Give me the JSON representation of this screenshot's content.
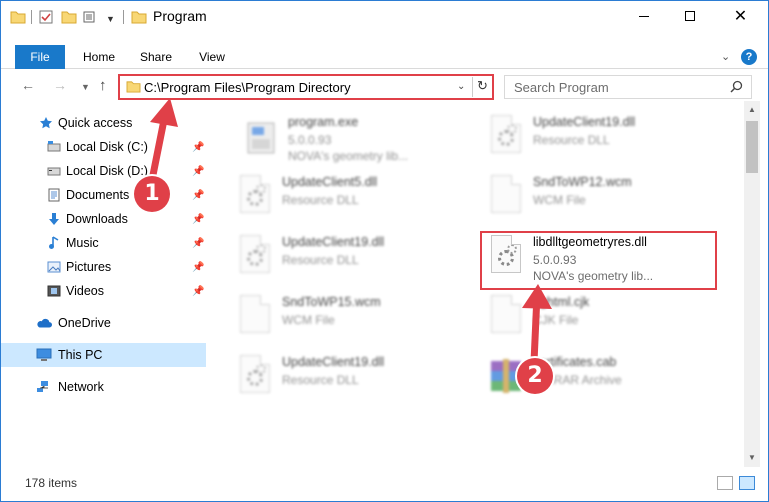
{
  "window": {
    "title": "Program",
    "controls": {
      "minimize": "",
      "maximize": "",
      "close": "✕"
    }
  },
  "ribbon": {
    "tabs": [
      "File",
      "Home",
      "Share",
      "View"
    ]
  },
  "address": {
    "path": "C:\\Program Files\\Program Directory",
    "search_placeholder": "Search Program"
  },
  "sidebar": {
    "quick_access": "Quick access",
    "pinned": [
      {
        "label": "Local Disk (C:)",
        "icon": "drive-icon"
      },
      {
        "label": "Local Disk (D:)",
        "icon": "drive-icon"
      },
      {
        "label": "Documents",
        "icon": "documents-icon"
      },
      {
        "label": "Downloads",
        "icon": "downloads-icon"
      },
      {
        "label": "Music",
        "icon": "music-icon"
      },
      {
        "label": "Pictures",
        "icon": "pictures-icon"
      },
      {
        "label": "Videos",
        "icon": "videos-icon"
      }
    ],
    "onedrive": "OneDrive",
    "this_pc": "This PC",
    "network": "Network"
  },
  "files": [
    {
      "name": "program.exe",
      "line2": "5.0.0.93",
      "line3": "NOVA's geometry lib...",
      "icon": "exe-icon",
      "blurred": true
    },
    {
      "name": "UpdateClient19.dll",
      "line2": "Resource DLL",
      "line3": "",
      "icon": "dll-icon",
      "blurred": true
    },
    {
      "name": "UpdateClient5.dll",
      "line2": "Resource DLL",
      "line3": "",
      "icon": "dll-icon",
      "blurred": true
    },
    {
      "name": "SndToWP12.wcm",
      "line2": "WCM File",
      "line3": "",
      "icon": "file-icon",
      "blurred": true
    },
    {
      "name": "UpdateClient19.dll",
      "line2": "Resource DLL",
      "line3": "",
      "icon": "dll-icon",
      "blurred": true
    },
    {
      "name": "libdlltgeometryres.dll",
      "line2": "5.0.0.93",
      "line3": "NOVA's geometry lib...",
      "icon": "dll-icon",
      "blurred": false
    },
    {
      "name": "SndToWP15.wcm",
      "line2": "WCM File",
      "line3": "",
      "icon": "file-icon",
      "blurred": true
    },
    {
      "name": "nghtml.cjk",
      "line2": "CJK File",
      "line3": "",
      "icon": "file-icon",
      "blurred": true
    },
    {
      "name": "UpdateClient19.dll",
      "line2": "Resource DLL",
      "line3": "",
      "icon": "dll-icon",
      "blurred": true
    },
    {
      "name": "certificates.cab",
      "line2": "WinRAR Archive",
      "line3": "",
      "icon": "archive-icon",
      "blurred": true
    }
  ],
  "status": {
    "item_count": "178 items"
  },
  "callouts": {
    "one": "1",
    "two": "2"
  },
  "colors": {
    "accent": "#1979ca",
    "highlight": "#e04048",
    "selected": "#cce8ff"
  }
}
